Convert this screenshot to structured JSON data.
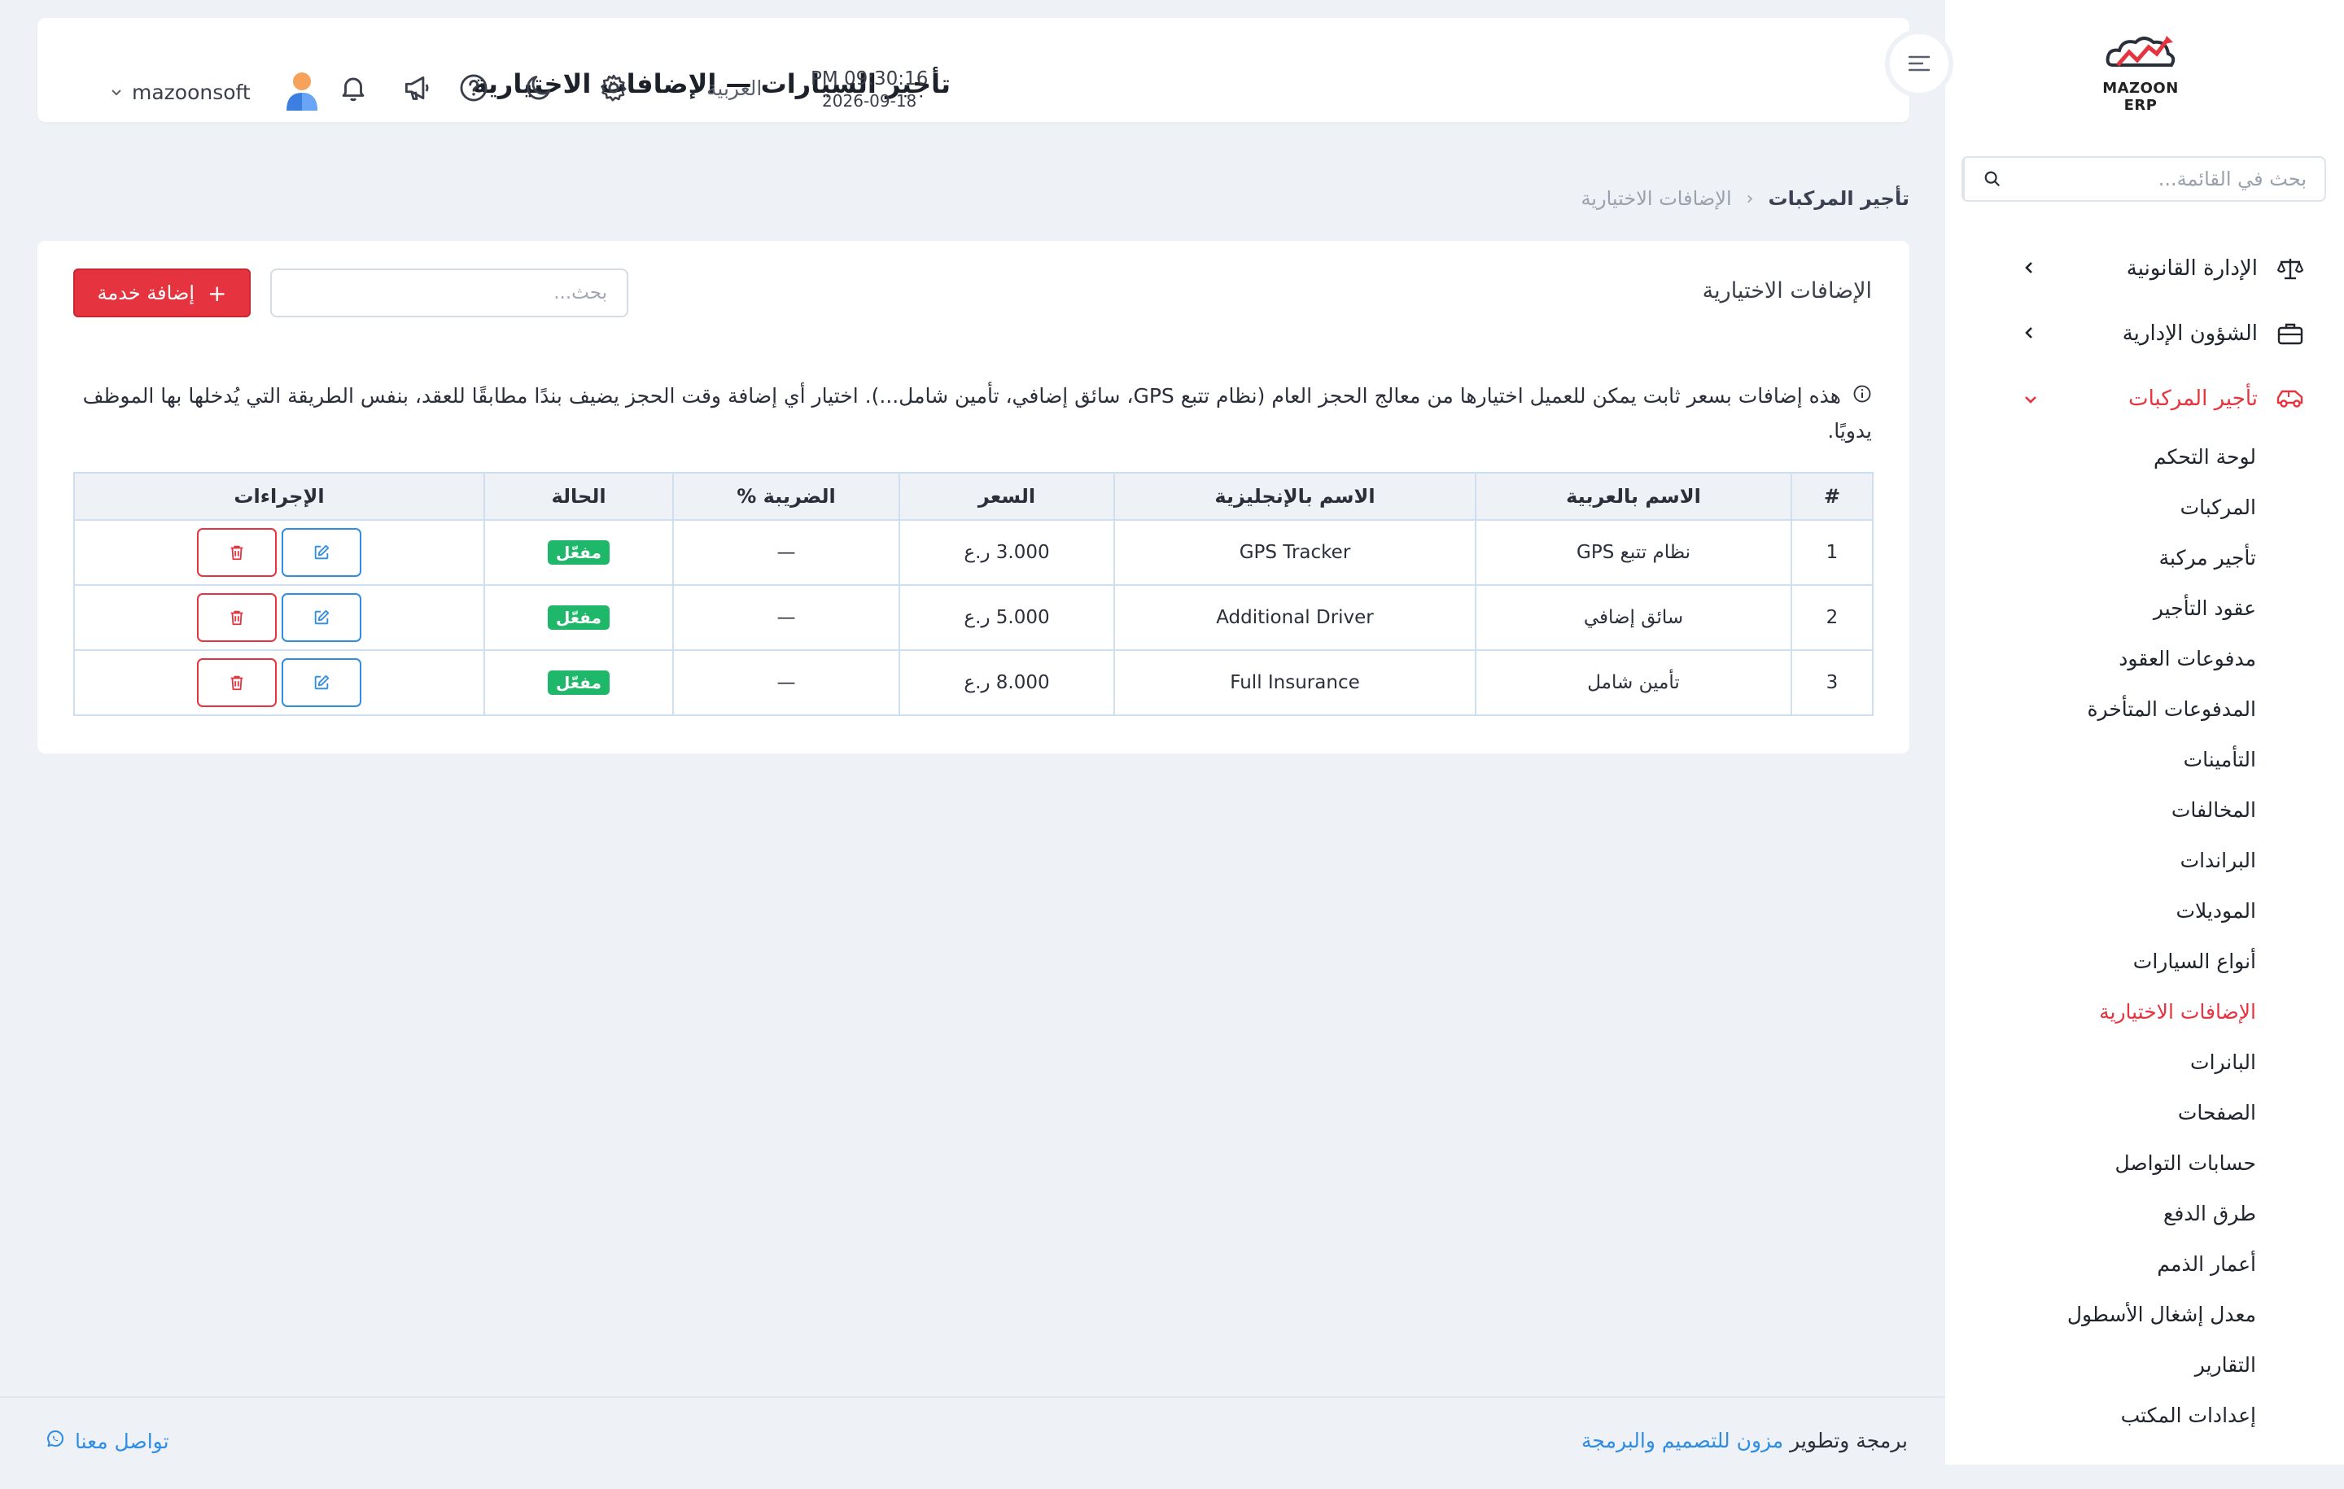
{
  "app": {
    "logo_text": "MAZOON ERP",
    "page_title": "تأجير السيارات — الإضافات الاختيارية"
  },
  "colors": {
    "accent": "#e5343f",
    "link": "#2f8de4",
    "success": "#1fb86a",
    "background": "#eef1f6"
  },
  "header": {
    "time": "PM 09:30:16",
    "date": "2026-09-18",
    "language": "العربية",
    "username": "mazoonsoft",
    "icons": [
      "settings-icon",
      "moon-icon",
      "help-icon",
      "megaphone-icon",
      "bell-icon",
      "avatar"
    ]
  },
  "sidebar": {
    "search_placeholder": "بحث في القائمة...",
    "groups": [
      {
        "label": "الإدارة القانونية",
        "icon": "scales-icon",
        "expanded": false
      },
      {
        "label": "الشؤون الإدارية",
        "icon": "briefcase-icon",
        "expanded": false
      },
      {
        "label": "تأجير المركبات",
        "icon": "car-icon",
        "expanded": true
      }
    ],
    "items": [
      {
        "label": "لوحة التحكم"
      },
      {
        "label": "المركبات"
      },
      {
        "label": "تأجير مركبة"
      },
      {
        "label": "عقود التأجير"
      },
      {
        "label": "مدفوعات العقود"
      },
      {
        "label": "المدفوعات المتأخرة"
      },
      {
        "label": "التأمينات"
      },
      {
        "label": "المخالفات"
      },
      {
        "label": "البراندات"
      },
      {
        "label": "الموديلات"
      },
      {
        "label": "أنواع السيارات"
      },
      {
        "label": "الإضافات الاختيارية",
        "active": true
      },
      {
        "label": "البانرات"
      },
      {
        "label": "الصفحات"
      },
      {
        "label": "حسابات التواصل"
      },
      {
        "label": "طرق الدفع"
      },
      {
        "label": "أعمار الذمم"
      },
      {
        "label": "معدل إشغال الأسطول"
      },
      {
        "label": "التقارير"
      },
      {
        "label": "إعدادات المكتب"
      }
    ]
  },
  "breadcrumb": {
    "parent": "تأجير المركبات",
    "separator": "‹",
    "current": "الإضافات الاختيارية"
  },
  "card": {
    "title": "الإضافات الاختيارية",
    "search_placeholder": "بحث...",
    "add_button": "إضافة خدمة",
    "info_text": "هذه إضافات بسعر ثابت يمكن للعميل اختيارها من معالج الحجز العام (نظام تتبع GPS، سائق إضافي، تأمين شامل...). اختيار أي إضافة وقت الحجز يضيف بندًا مطابقًا للعقد، بنفس الطريقة التي يُدخلها بها الموظف يدويًا."
  },
  "table": {
    "headers": [
      "#",
      "الاسم بالعربية",
      "الاسم بالإنجليزية",
      "السعر",
      "الضريبة %",
      "الحالة",
      "الإجراءات"
    ],
    "rows": [
      {
        "num": "1",
        "name_ar": "نظام تتبع GPS",
        "name_en": "GPS Tracker",
        "price": "3.000 ر.ع",
        "tax": "—",
        "status": "مفعّل"
      },
      {
        "num": "2",
        "name_ar": "سائق إضافي",
        "name_en": "Additional Driver",
        "price": "5.000 ر.ع",
        "tax": "—",
        "status": "مفعّل"
      },
      {
        "num": "3",
        "name_ar": "تأمين شامل",
        "name_en": "Full Insurance",
        "price": "8.000 ر.ع",
        "tax": "—",
        "status": "مفعّل"
      }
    ]
  },
  "footer": {
    "credit_prefix": "برمجة وتطوير",
    "credit_link": "مزون للتصميم والبرمجة",
    "contact": "تواصل معنا"
  }
}
